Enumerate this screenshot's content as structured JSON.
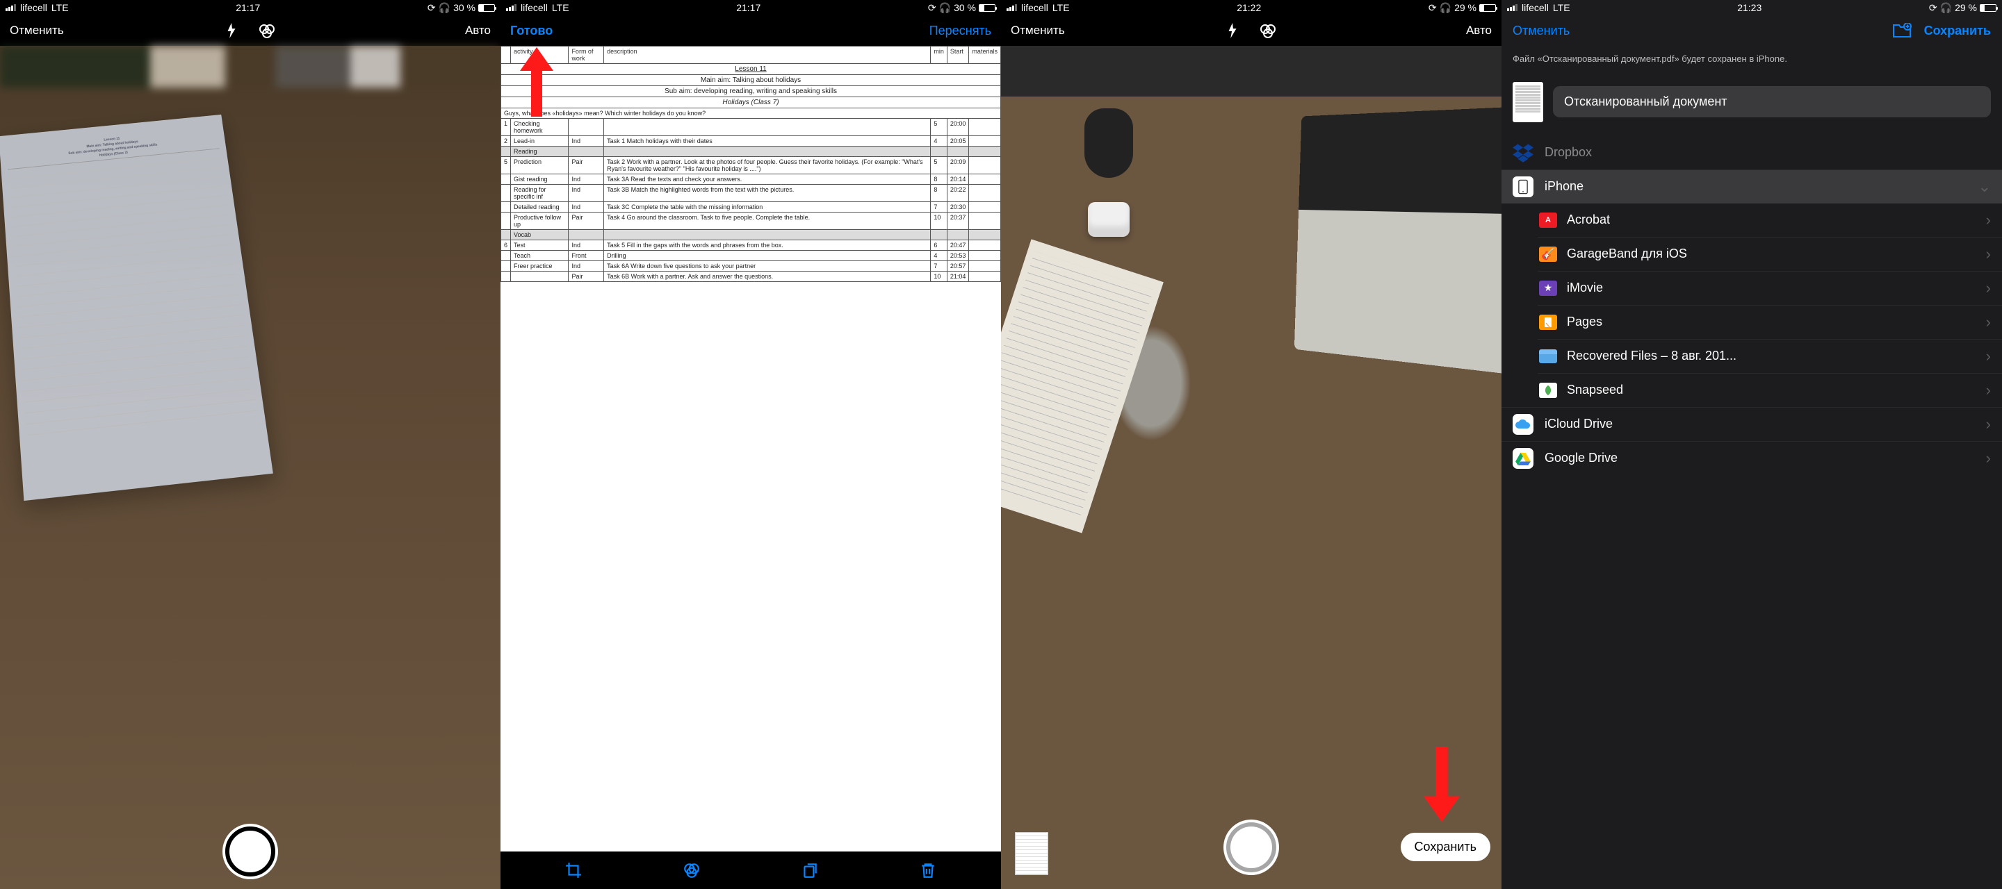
{
  "status": {
    "carrier": "lifecell",
    "network": "LTE",
    "time1": "21:17",
    "time3": "21:22",
    "time4": "21:23",
    "battery1": "30 %",
    "battery3": "29 %",
    "battery4": "29 %"
  },
  "screen1": {
    "cancel": "Отменить",
    "auto": "Авто"
  },
  "screen2": {
    "done": "Готово",
    "retake": "Переснять",
    "doc": {
      "col1": "activity",
      "col2": "Form of work",
      "col3": "description",
      "col4": "min",
      "col5": "Start",
      "col6": "materials",
      "lesson": "Lesson 11",
      "main_aim": "Main aim: Talking about holidays",
      "sub_aim": "Sub aim: developing reading, writing and speaking skills",
      "class": "Holidays (Class 7)",
      "q": "Guys, what does «holidays» mean? Which winter holidays do you know?",
      "rows": [
        {
          "n": "1",
          "act": "Checking homework",
          "form": "",
          "desc": "",
          "min": "5",
          "start": "20:00"
        },
        {
          "n": "2",
          "act": "Lead-in",
          "form": "Ind",
          "desc": "Task 1 Match holidays with their dates",
          "min": "4",
          "start": "20:05"
        },
        {
          "n": "",
          "act": "Reading",
          "form": "",
          "desc": "",
          "min": "",
          "start": "",
          "shaded": true
        },
        {
          "n": "5",
          "act": "Prediction",
          "form": "Pair",
          "desc": "Task 2 Work with a partner. Look at the photos of four people. Guess their favorite holidays. (For example: \"What's Ryan's favourite weather?\" \"His favourite holiday is ....\")",
          "min": "5",
          "start": "20:09"
        },
        {
          "n": "",
          "act": "Gist reading",
          "form": "Ind",
          "desc": "Task 3A Read the texts and check your answers.",
          "min": "8",
          "start": "20:14"
        },
        {
          "n": "",
          "act": "Reading for specific inf",
          "form": "Ind",
          "desc": "Task 3B Match the highlighted words from the text with the pictures.",
          "min": "8",
          "start": "20:22"
        },
        {
          "n": "",
          "act": "Detailed reading",
          "form": "Ind",
          "desc": "Task 3C Complete the table with the missing information",
          "min": "7",
          "start": "20:30"
        },
        {
          "n": "",
          "act": "Productive follow up",
          "form": "Pair",
          "desc": "Task 4 Go around the classroom. Task to five people. Complete the table.",
          "min": "10",
          "start": "20:37"
        },
        {
          "n": "",
          "act": "Vocab",
          "form": "",
          "desc": "",
          "min": "",
          "start": "",
          "shaded": true
        },
        {
          "n": "6",
          "act": "Test",
          "form": "Ind",
          "desc": "Task 5 Fill in the gaps with the words and phrases from the box.",
          "min": "6",
          "start": "20:47"
        },
        {
          "n": "",
          "act": "Teach",
          "form": "Front",
          "desc": "Drilling",
          "min": "4",
          "start": "20:53"
        },
        {
          "n": "",
          "act": "Freer practice",
          "form": "Ind",
          "desc": "Task 6A Write down five questions to ask your partner",
          "min": "7",
          "start": "20:57"
        },
        {
          "n": "",
          "act": "",
          "form": "Pair",
          "desc": "Task 6B Work with a partner. Ask and answer the questions.",
          "min": "10",
          "start": "21:04"
        }
      ]
    }
  },
  "screen3": {
    "cancel": "Отменить",
    "auto": "Авто",
    "save": "Сохранить"
  },
  "screen4": {
    "cancel": "Отменить",
    "save": "Сохранить",
    "info": "Файл «Отсканированный документ.pdf» будет сохранен в iPhone.",
    "filename": "Отсканированный документ",
    "dropbox": "Dropbox",
    "iphone": "iPhone",
    "apps": {
      "acrobat": "Acrobat",
      "garageband": "GarageBand для iOS",
      "imovie": "iMovie",
      "pages": "Pages",
      "recovered": "Recovered Files – 8 авг. 201...",
      "snapseed": "Snapseed"
    },
    "icloud": "iCloud Drive",
    "gdrive": "Google Drive"
  }
}
